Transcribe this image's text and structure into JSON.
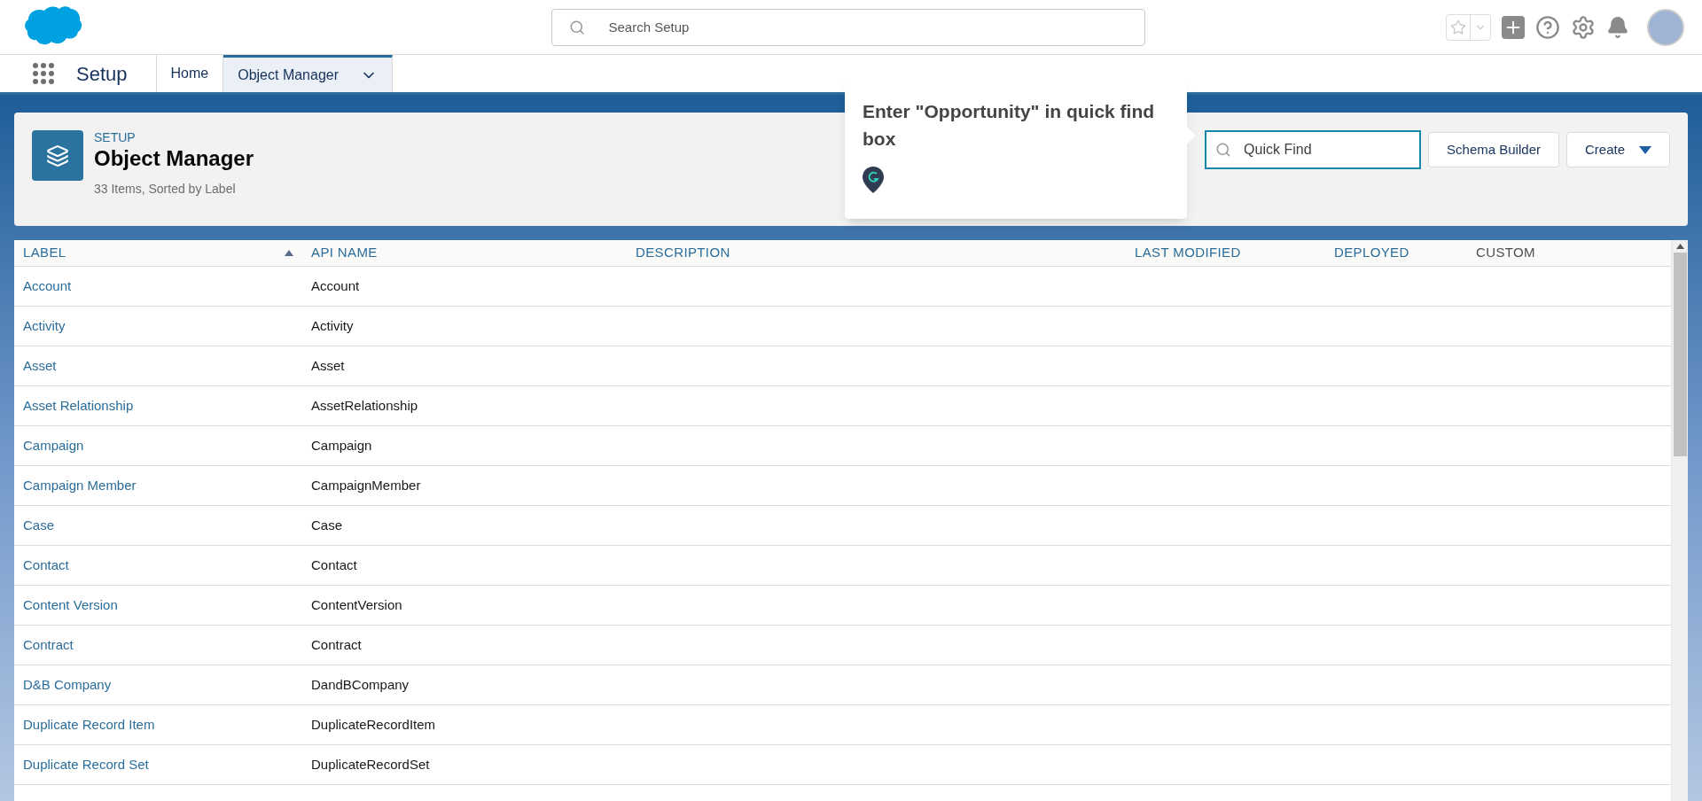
{
  "global_search": {
    "placeholder": "Search Setup"
  },
  "nav": {
    "app_name": "Setup",
    "tabs": [
      {
        "label": "Home",
        "selected": false,
        "has_menu": false
      },
      {
        "label": "Object Manager",
        "selected": true,
        "has_menu": true
      }
    ]
  },
  "header": {
    "eyebrow": "SETUP",
    "title": "Object Manager",
    "subtitle": "33 Items, Sorted by Label",
    "quick_find": {
      "placeholder": "Quick Find"
    },
    "buttons": [
      {
        "label": "Schema Builder",
        "has_menu": false
      },
      {
        "label": "Create",
        "has_menu": true
      }
    ]
  },
  "tooltip": {
    "text": "Enter \"Opportunity\" in quick find box"
  },
  "table": {
    "columns": [
      {
        "label": "LABEL",
        "sortable": true,
        "sorted": true
      },
      {
        "label": "API NAME",
        "sortable": true,
        "sorted": false
      },
      {
        "label": "DESCRIPTION",
        "sortable": true,
        "sorted": false
      },
      {
        "label": "LAST MODIFIED",
        "sortable": true,
        "sorted": false
      },
      {
        "label": "DEPLOYED",
        "sortable": true,
        "sorted": false
      },
      {
        "label": "CUSTOM",
        "sortable": false,
        "sorted": false
      }
    ],
    "rows": [
      {
        "label": "Account",
        "api_name": "Account"
      },
      {
        "label": "Activity",
        "api_name": "Activity"
      },
      {
        "label": "Asset",
        "api_name": "Asset"
      },
      {
        "label": "Asset Relationship",
        "api_name": "AssetRelationship"
      },
      {
        "label": "Campaign",
        "api_name": "Campaign"
      },
      {
        "label": "Campaign Member",
        "api_name": "CampaignMember"
      },
      {
        "label": "Case",
        "api_name": "Case"
      },
      {
        "label": "Contact",
        "api_name": "Contact"
      },
      {
        "label": "Content Version",
        "api_name": "ContentVersion"
      },
      {
        "label": "Contract",
        "api_name": "Contract"
      },
      {
        "label": "D&B Company",
        "api_name": "DandBCompany"
      },
      {
        "label": "Duplicate Record Item",
        "api_name": "DuplicateRecordItem"
      },
      {
        "label": "Duplicate Record Set",
        "api_name": "DuplicateRecordSet"
      }
    ]
  }
}
